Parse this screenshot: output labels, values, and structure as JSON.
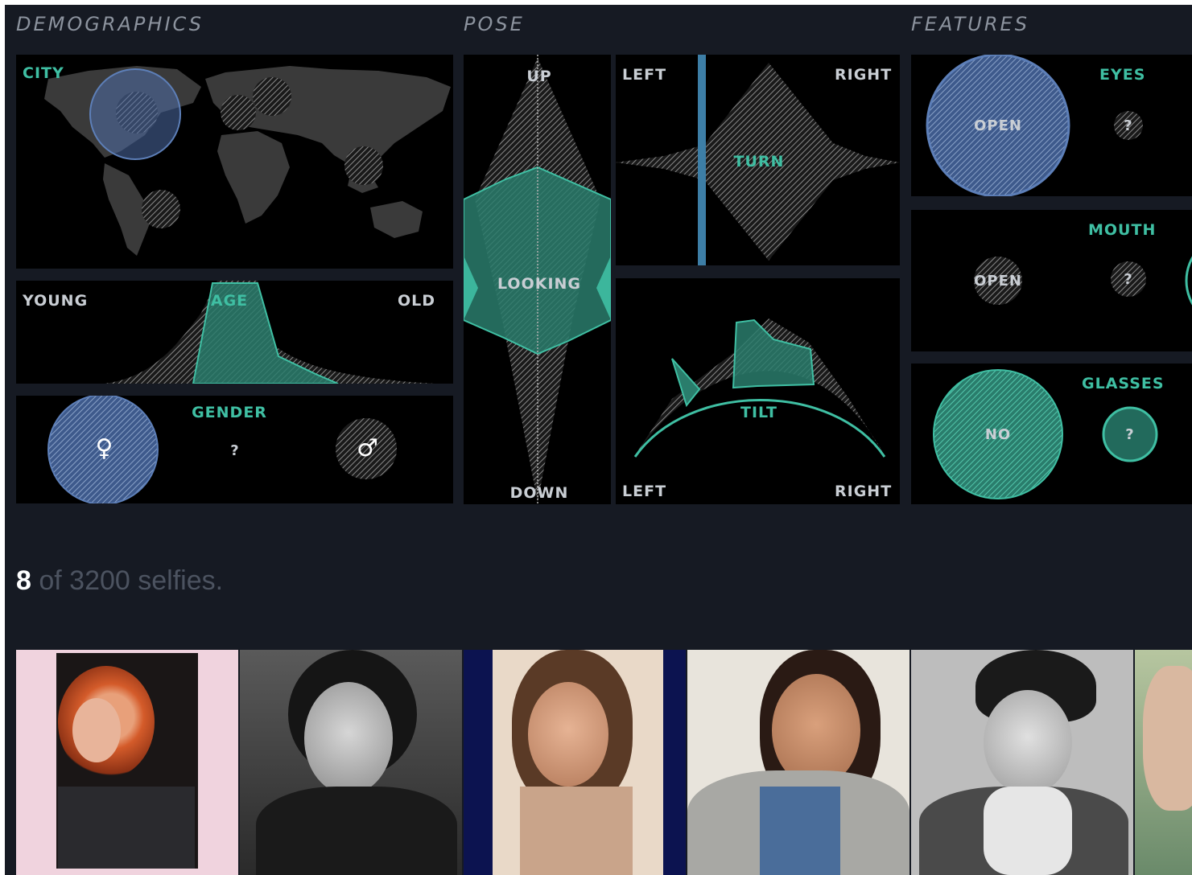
{
  "sections": {
    "demographics": "DEMOGRAPHICS",
    "pose": "POSE",
    "features": "FEATURES"
  },
  "demographics": {
    "city_label": "CITY",
    "age": {
      "young": "YOUNG",
      "title": "AGE",
      "old": "OLD"
    },
    "gender": {
      "title": "GENDER",
      "female_icon": "♀",
      "unknown": "?",
      "male_icon": "♂"
    }
  },
  "pose": {
    "looking": {
      "up": "UP",
      "title": "LOOKING",
      "down": "DOWN"
    },
    "turn": {
      "left": "LEFT",
      "title": "TURN",
      "right": "RIGHT"
    },
    "tilt": {
      "left": "LEFT",
      "title": "TILT",
      "right": "RIGHT"
    }
  },
  "features": {
    "eyes": {
      "title": "EYES",
      "open": "OPEN",
      "unknown": "?"
    },
    "mouth": {
      "title": "MOUTH",
      "open": "OPEN",
      "unknown": "?"
    },
    "glasses": {
      "title": "GLASSES",
      "no": "NO",
      "unknown": "?"
    }
  },
  "results": {
    "shown": "8",
    "rest": "of 3200 selfies."
  },
  "colors": {
    "background": "#161a23",
    "panel": "#000000",
    "teal": "#3fbfa3",
    "selection_blue": "#4e6ea8",
    "label": "#c9ced4"
  },
  "thumbnails": [
    {
      "name": "selfie-1",
      "style": "pink frame, red hair"
    },
    {
      "name": "selfie-2",
      "style": "black and white, dark hair"
    },
    {
      "name": "selfie-3",
      "style": "navy border, brown hair"
    },
    {
      "name": "selfie-4",
      "style": "smiling, denim shirt"
    },
    {
      "name": "selfie-5",
      "style": "black and white, beret"
    },
    {
      "name": "selfie-6",
      "style": "partial, green tint"
    }
  ]
}
